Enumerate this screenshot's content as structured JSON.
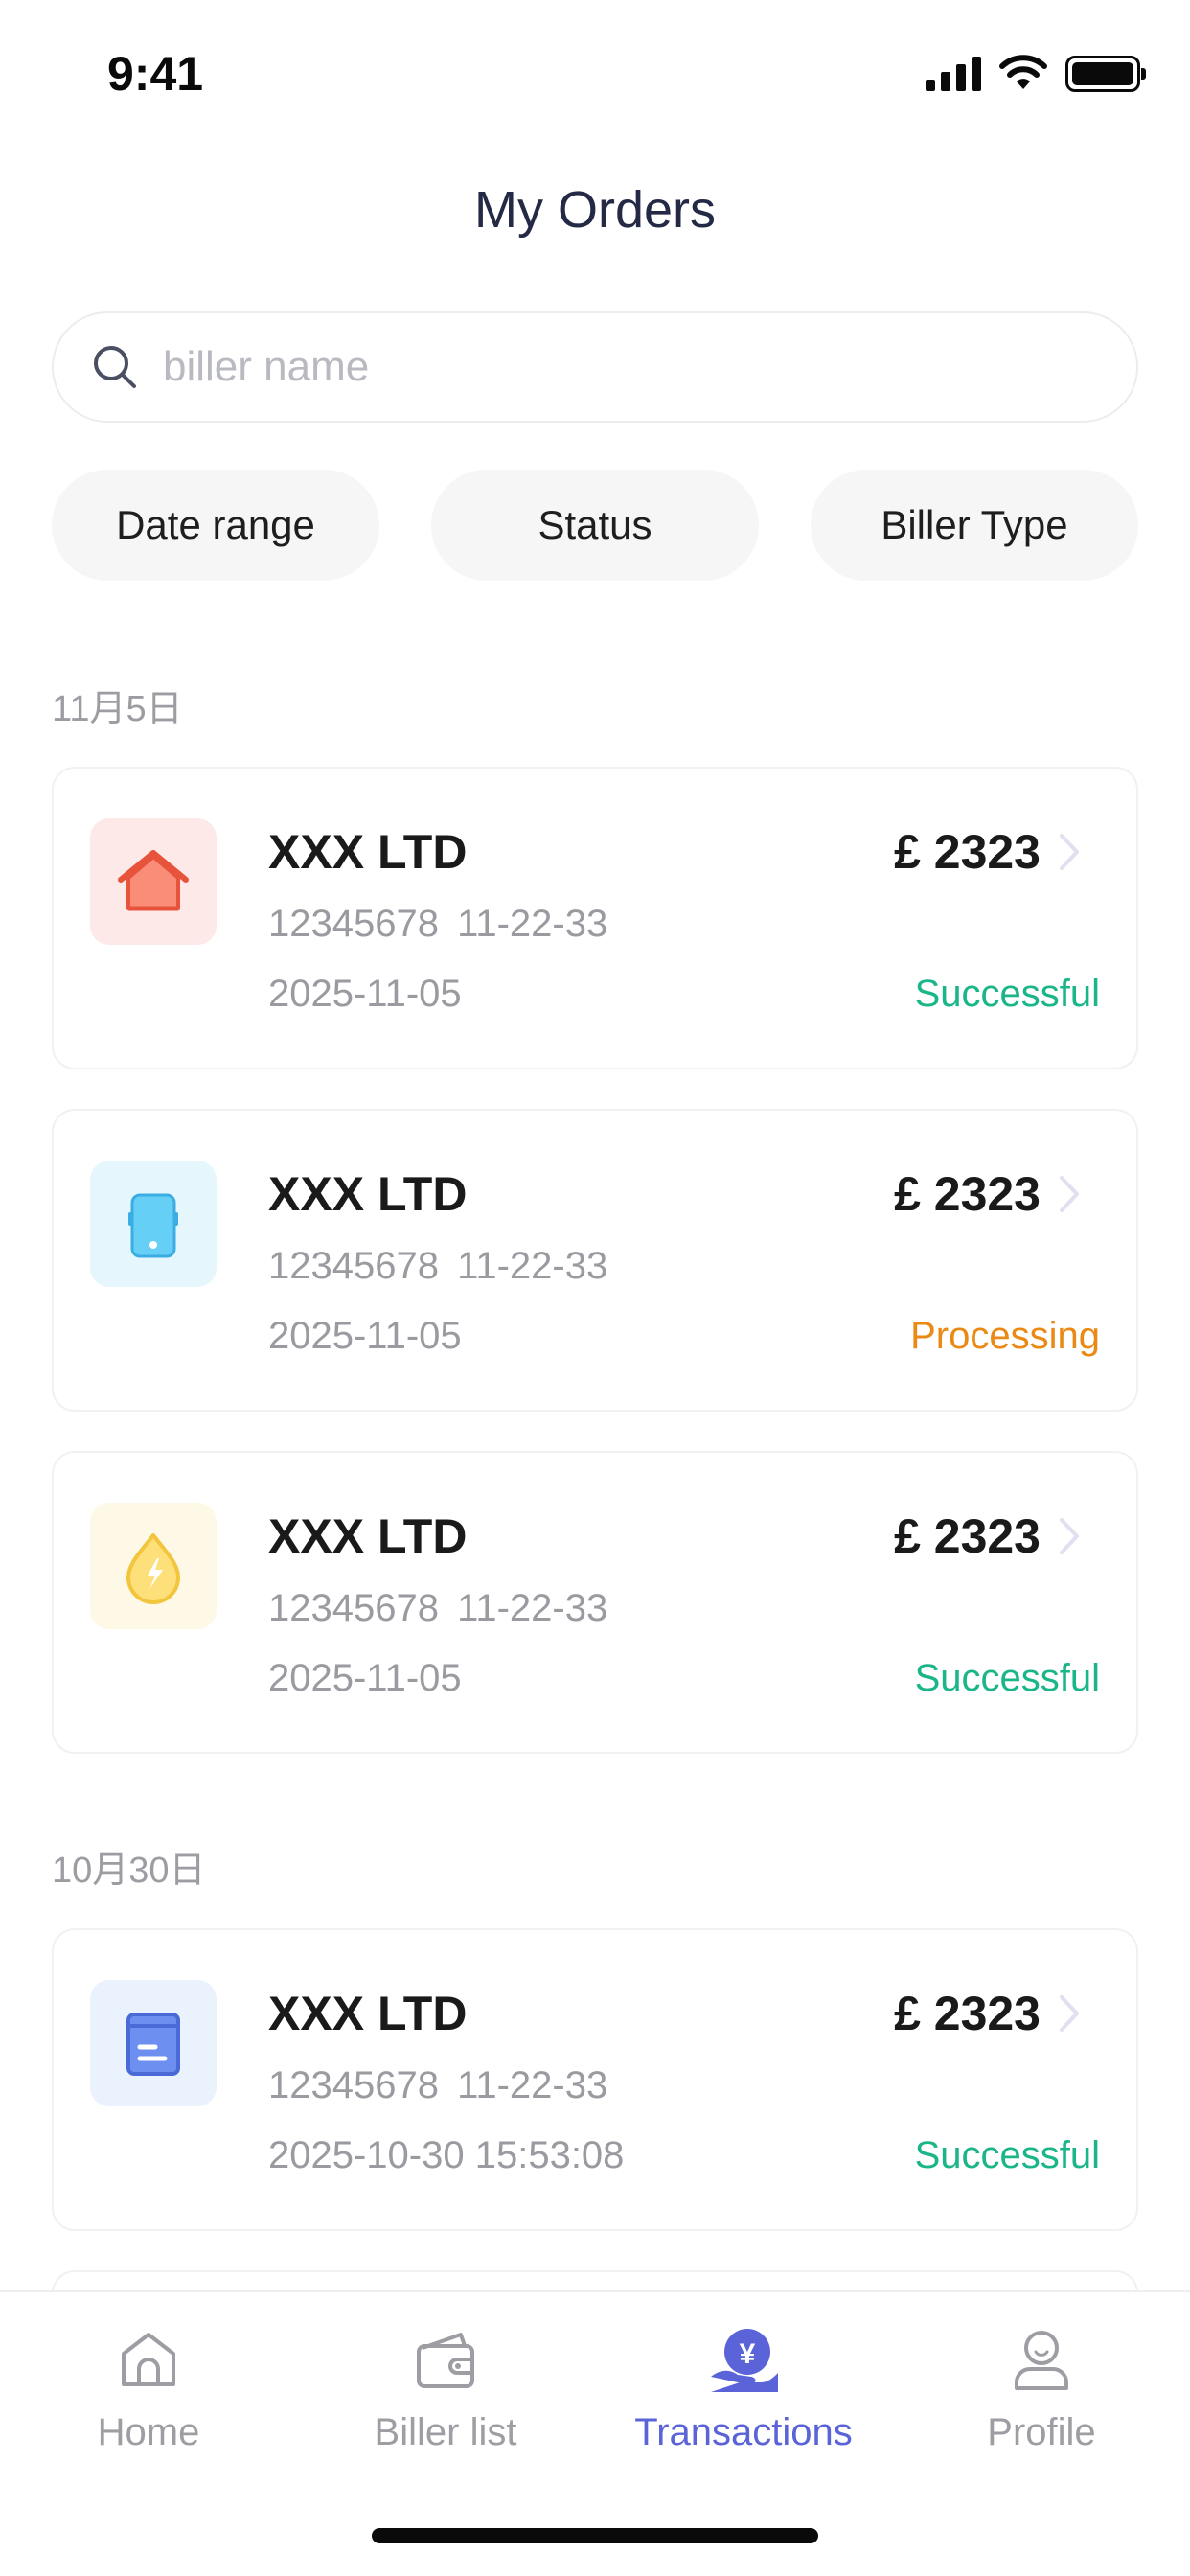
{
  "status_bar": {
    "time": "9:41"
  },
  "header": {
    "title": "My Orders"
  },
  "search": {
    "placeholder": "biller name",
    "value": ""
  },
  "filters": [
    {
      "label": "Date range"
    },
    {
      "label": "Status"
    },
    {
      "label": "Biller Type"
    }
  ],
  "groups": [
    {
      "date_label": "11月5日"
    },
    {
      "date_label": "10月30日"
    }
  ],
  "orders": [
    {
      "icon": "home-icon",
      "name": "XXX LTD",
      "account": "12345678  11-22-33",
      "date": "2025-11-05",
      "amount": "£ 2323",
      "status": "Successful"
    },
    {
      "icon": "phone-icon",
      "name": "XXX LTD",
      "account": "12345678  11-22-33",
      "date": "2025-11-05",
      "amount": "£ 2323",
      "status": "Processing"
    },
    {
      "icon": "energy-drop-icon",
      "name": "XXX LTD",
      "account": "12345678  11-22-33",
      "date": "2025-11-05",
      "amount": "£ 2323",
      "status": "Successful"
    },
    {
      "icon": "bill-card-icon",
      "name": "XXX LTD",
      "account": "12345678  11-22-33",
      "date": "2025-10-30 15:53:08",
      "amount": "£ 2323",
      "status": "Successful"
    }
  ],
  "tab_bar": {
    "tabs": [
      {
        "label": "Home",
        "icon": "home-outline-icon",
        "active": false
      },
      {
        "label": "Biller list",
        "icon": "wallet-icon",
        "active": false
      },
      {
        "label": "Transactions",
        "icon": "yen-hand-icon",
        "active": true
      },
      {
        "label": "Profile",
        "icon": "profile-icon",
        "active": false
      }
    ]
  },
  "colors": {
    "accent": "#5b63d8",
    "success": "#1bb58a",
    "processing": "#ea8a14",
    "title": "#242a45"
  }
}
